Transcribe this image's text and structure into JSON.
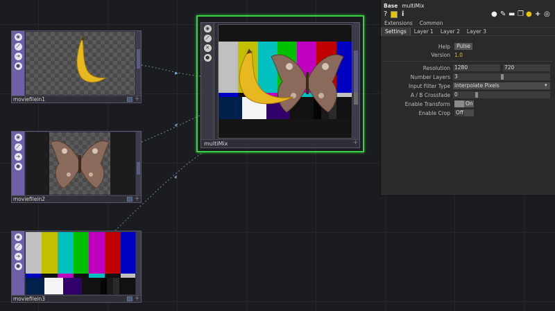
{
  "nodes": {
    "moviefilein1": {
      "name": "moviefilein1"
    },
    "moviefilein2": {
      "name": "moviefilein2"
    },
    "moviefilein3": {
      "name": "moviefilein3"
    },
    "multimix": {
      "name": "multiMix"
    }
  },
  "panel": {
    "type": "Base",
    "name": "multiMix",
    "page_tabs": [
      "Extensions",
      "Common"
    ],
    "sub_tabs": [
      "Settings",
      "Layer 1",
      "Layer 2",
      "Layer 3"
    ],
    "active_sub_tab": "Settings",
    "params": {
      "help": {
        "label": "Help",
        "value": "Pulse"
      },
      "version": {
        "label": "Version",
        "value": "1.0"
      },
      "resolution": {
        "label": "Resolution",
        "w": "1280",
        "h": "720"
      },
      "num_layers": {
        "label": "Number Layers",
        "value": "3",
        "fraction": 0.45
      },
      "filter_type": {
        "label": "Input Filter Type",
        "value": "Interpolate Pixels"
      },
      "crossfade": {
        "label": "A / B Crossfade",
        "value": "0",
        "fraction": 0.0
      },
      "enable_transform": {
        "label": "Enable Transform",
        "value": "On"
      },
      "enable_crop": {
        "label": "Enable Crop",
        "value": "Off"
      }
    },
    "colors": {
      "value_yellow": "#e8c400",
      "toggle_on": "#5a5a5a"
    }
  },
  "colorbars": [
    "#c0c0c0",
    "#c0c000",
    "#00c0c0",
    "#00c000",
    "#c000c0",
    "#c00000",
    "#0000c0"
  ],
  "selection_color": "#39d13f"
}
